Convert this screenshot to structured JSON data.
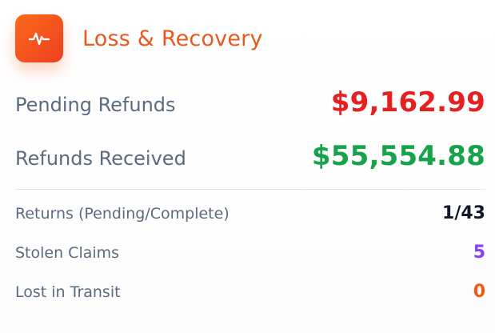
{
  "header": {
    "title": "Loss & Recovery",
    "icon": "activity-pulse-icon",
    "accent_color": "#e8591d"
  },
  "summary": [
    {
      "label": "Pending Refunds",
      "value": "$9,162.99",
      "color": "#e42020"
    },
    {
      "label": "Refunds Received",
      "value": "$55,554.88",
      "color": "#17a34a"
    }
  ],
  "details": [
    {
      "label": "Returns (Pending/Complete)",
      "value": "1/43",
      "color": "#111827"
    },
    {
      "label": "Stolen Claims",
      "value": "5",
      "color": "#8b3df2"
    },
    {
      "label": "Lost in Transit",
      "value": "0",
      "color": "#f05a14"
    }
  ]
}
